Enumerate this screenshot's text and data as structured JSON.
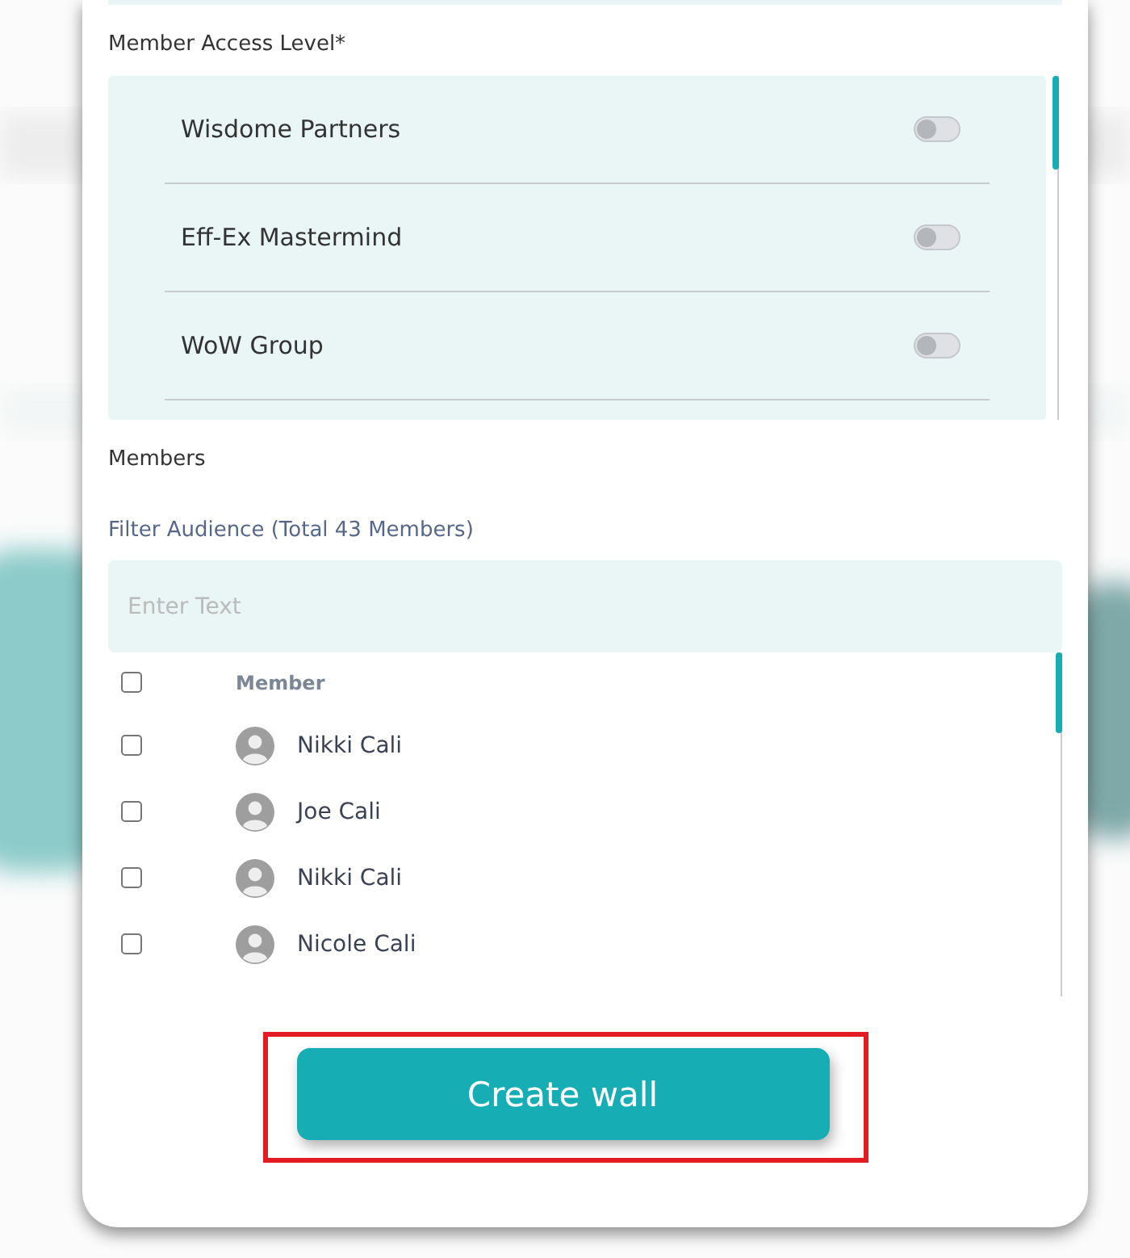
{
  "access_level": {
    "label": "Member Access Level*",
    "groups": [
      {
        "name": "Wisdome Partners",
        "on": false
      },
      {
        "name": "Eff-Ex Mastermind",
        "on": false
      },
      {
        "name": "WoW Group",
        "on": false
      }
    ]
  },
  "members": {
    "label": "Members",
    "filter_label": "Filter Audience (Total 43 Members)",
    "search": {
      "placeholder": "Enter Text"
    },
    "table": {
      "column": "Member",
      "all_checked": false,
      "rows": [
        {
          "name": "Nikki Cali",
          "checked": false
        },
        {
          "name": "Joe Cali",
          "checked": false
        },
        {
          "name": "Nikki Cali",
          "checked": false
        },
        {
          "name": "Nicole Cali",
          "checked": false
        }
      ]
    }
  },
  "button": "Create wall"
}
